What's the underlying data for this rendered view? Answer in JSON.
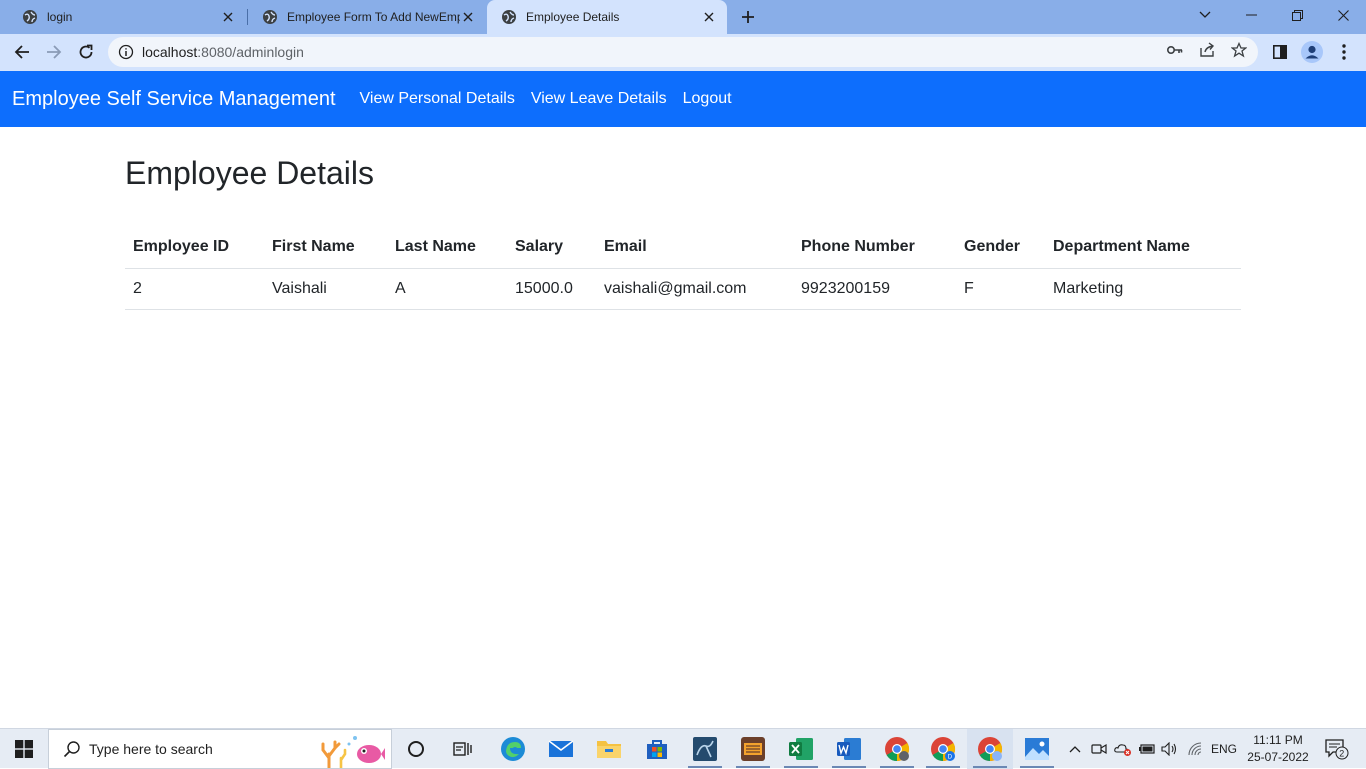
{
  "browser": {
    "tabs": [
      {
        "title": "login",
        "active": false
      },
      {
        "title": "Employee Form To Add NewEmployee",
        "active": false
      },
      {
        "title": "Employee Details",
        "active": true
      }
    ],
    "url_host": "localhost",
    "url_path": ":8080/adminlogin"
  },
  "navbar": {
    "brand": "Employee Self Service Management",
    "links": [
      "View Personal Details",
      "View Leave Details",
      "Logout"
    ],
    "color": "#0d6efd"
  },
  "page": {
    "title": "Employee Details",
    "table": {
      "headers": [
        "Employee ID",
        "First Name",
        "Last Name",
        "Salary",
        "Email",
        "Phone Number",
        "Gender",
        "Department Name"
      ],
      "rows": [
        [
          "2",
          "Vaishali",
          "A",
          "15000.0",
          "vaishali@gmail.com",
          "9923200159",
          "F",
          "Marketing"
        ]
      ]
    }
  },
  "taskbar": {
    "search_placeholder": "Type here to search",
    "language": "ENG",
    "time": "11:11 PM",
    "date": "25-07-2022",
    "notification_count": "2",
    "apps": [
      "cortana-icon",
      "task-view-icon",
      "edge-icon",
      "mail-icon",
      "file-explorer-icon",
      "store-icon",
      "mysql-workbench-icon",
      "xampp-icon",
      "excel-icon",
      "word-icon",
      "chrome-icon",
      "chrome-profile-icon",
      "chrome-active-icon",
      "photos-icon"
    ]
  }
}
